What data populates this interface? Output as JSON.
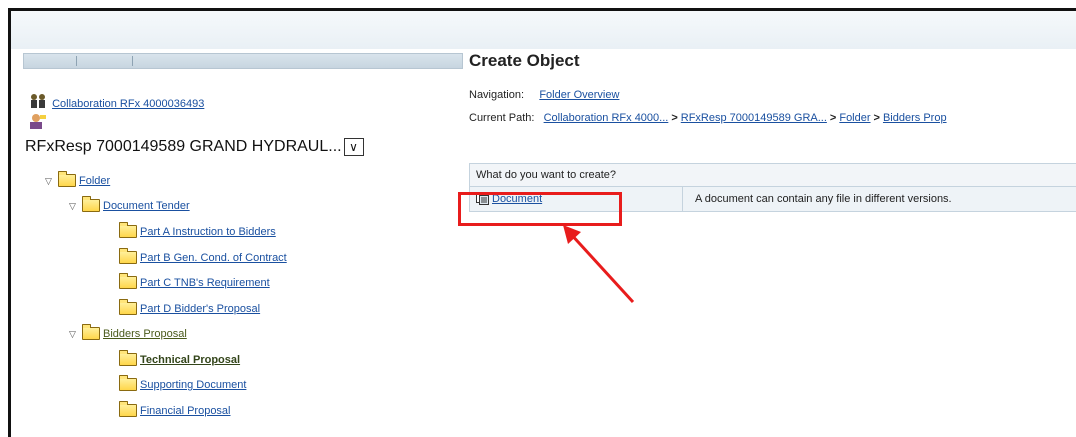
{
  "left": {
    "collaboration_link": "Collaboration RFx 4000036493",
    "rfx_dropdown_value": "RFxResp 7000149589 GRAND HYDRAUL...",
    "tree": [
      {
        "label": "Folder",
        "expanded": true
      },
      {
        "label": "Document Tender",
        "expanded": true
      },
      {
        "label": "Part A Instruction to Bidders"
      },
      {
        "label": "Part B Gen. Cond. of Contract"
      },
      {
        "label": "Part C TNB's Requirement"
      },
      {
        "label": "Part D Bidder's Proposal"
      },
      {
        "label": "Bidders Proposal",
        "expanded": true
      },
      {
        "label": "Technical Proposal",
        "selected": true
      },
      {
        "label": "Supporting Document"
      },
      {
        "label": "Financial Proposal"
      }
    ]
  },
  "right": {
    "title": "Create Object",
    "navigation_label": "Navigation:",
    "navigation_link": "Folder Overview",
    "path_label": "Current Path:",
    "path": [
      "Collaboration RFx 4000...",
      "RFxResp 7000149589 GRA...",
      "Folder",
      "Bidders Prop"
    ],
    "path_separator": ">",
    "table_header": "What do you want to create?",
    "row_link": "Document",
    "row_description": "A document can contain any file in different versions."
  },
  "colors": {
    "highlight": "#e81c1c",
    "link": "#1a50a0"
  }
}
